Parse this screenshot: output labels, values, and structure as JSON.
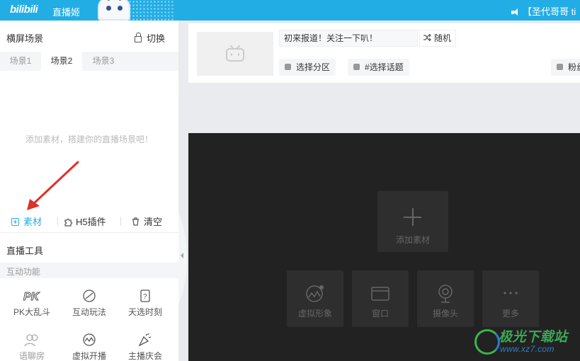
{
  "topbar": {
    "logo": "bilibili",
    "app_title": "直播姬",
    "notice": "【圣代哥哥 ti"
  },
  "scene": {
    "title": "横屏场景",
    "switch_label": "切换",
    "tabs": [
      {
        "label": "场景1"
      },
      {
        "label": "场景2"
      },
      {
        "label": "场景3"
      }
    ],
    "active_tab": "场景2",
    "empty_hint": "添加素材，搭建你的直播场景吧！"
  },
  "actions": {
    "material": "素材",
    "h5": "H5插件",
    "clear": "清空"
  },
  "tools": {
    "title": "直播工具",
    "section": "互动功能",
    "items": [
      {
        "label": "PK大乱斗",
        "icon": "pk-icon"
      },
      {
        "label": "互动玩法",
        "icon": "game-icon"
      },
      {
        "label": "天选时刻",
        "icon": "lottery-icon"
      },
      {
        "label": "语聊房",
        "icon": "voice-room-icon"
      },
      {
        "label": "虚拟开播",
        "icon": "virtual-live-icon"
      },
      {
        "label": "主播庆会",
        "icon": "celebration-icon"
      }
    ]
  },
  "room": {
    "title": "初来报道！关注一下叭！",
    "random_label": "随机",
    "category_label": "选择分区",
    "topic_label": "#选择话题",
    "fans_label": "粉丝"
  },
  "preview": {
    "add_label": "添加素材",
    "sources": [
      {
        "label": "虚拟形象",
        "icon": "avatar-icon"
      },
      {
        "label": "窗口",
        "icon": "window-icon"
      },
      {
        "label": "摄像头",
        "icon": "camera-icon"
      },
      {
        "label": "更多",
        "icon": "more-icon"
      }
    ]
  },
  "watermark": {
    "name": "极光下载站",
    "url": "www.xz7.com"
  },
  "colors": {
    "accent": "#23ade5",
    "arrow": "#e0302a",
    "preview_bg": "#222222"
  }
}
